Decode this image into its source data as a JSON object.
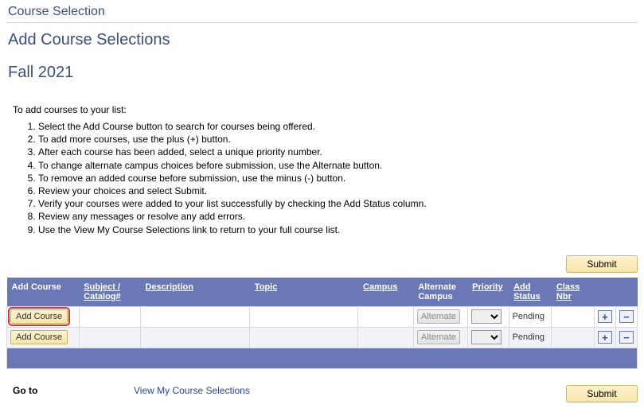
{
  "breadcrumb": "Course Selection",
  "page_title": "Add Course Selections",
  "term": "Fall 2021",
  "intro": "To add courses to your list:",
  "steps": [
    "Select the Add Course button to search for courses being offered.",
    "To add more courses, use the plus (+) button.",
    "After each course has been added, select a unique priority number.",
    "To change alternate campus choices before submission, use the Alternate button.",
    "To remove an added course before submission, use the minus (-) button.",
    "Review your choices and select Submit.",
    "Verify your courses were added to your list successfully by checking the Add Status column.",
    "Review any messages or resolve any add errors.",
    "Use the View My Course Selections link to return to your full course list."
  ],
  "buttons": {
    "submit": "Submit",
    "add_course": "Add Course",
    "alternate": "Alternate",
    "plus": "+",
    "minus": "−"
  },
  "headers": {
    "add_course": "Add Course",
    "subject": "Subject / Catalog#",
    "description": "Description",
    "topic": "Topic",
    "campus": "Campus",
    "alt_campus": "Alternate Campus",
    "priority": "Priority",
    "add_status": "Add Status",
    "class_nbr": "Class Nbr"
  },
  "rows": [
    {
      "highlight": true,
      "subject": "",
      "description": "",
      "topic": "",
      "campus": "",
      "priority": "",
      "add_status": "Pending",
      "class_nbr": ""
    },
    {
      "highlight": false,
      "subject": "",
      "description": "",
      "topic": "",
      "campus": "",
      "priority": "",
      "add_status": "Pending",
      "class_nbr": ""
    }
  ],
  "footer": {
    "goto": "Go to",
    "view_link": "View My Course Selections"
  }
}
